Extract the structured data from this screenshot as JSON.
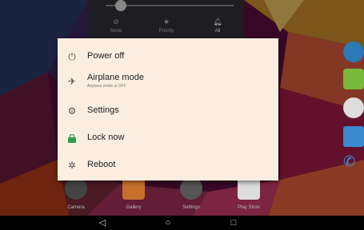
{
  "quick_settings": {
    "items": [
      {
        "label": "None",
        "icon": "no-sign-icon"
      },
      {
        "label": "Priority",
        "icon": "star-icon"
      },
      {
        "label": "All",
        "icon": "bell-icon"
      }
    ]
  },
  "power_menu": {
    "items": [
      {
        "label": "Power off",
        "icon": "power-icon"
      },
      {
        "label": "Airplane mode",
        "subtitle": "Airplane mode is OFF",
        "icon": "airplane-icon"
      },
      {
        "label": "Settings",
        "icon": "gear-icon"
      },
      {
        "label": "Lock now",
        "icon": "lock-icon"
      },
      {
        "label": "Reboot",
        "icon": "reboot-icon"
      }
    ]
  },
  "dock": {
    "apps": [
      {
        "label": "Camera",
        "icon": "camera-icon"
      },
      {
        "label": "Gallery",
        "icon": "gallery-icon"
      },
      {
        "label": "Settings",
        "icon": "settings-icon"
      },
      {
        "label": "Play Store",
        "icon": "play-store-icon"
      }
    ]
  },
  "side_apps": [
    "globe-icon",
    "android-icon",
    "apps-drawer-icon",
    "contacts-icon",
    "phone-icon"
  ],
  "navbar": {
    "back": "◁",
    "home": "○",
    "recents": "□"
  },
  "colors": {
    "dialog_bg": "#fbeee0",
    "lock_icon": "#2e9e4f"
  }
}
